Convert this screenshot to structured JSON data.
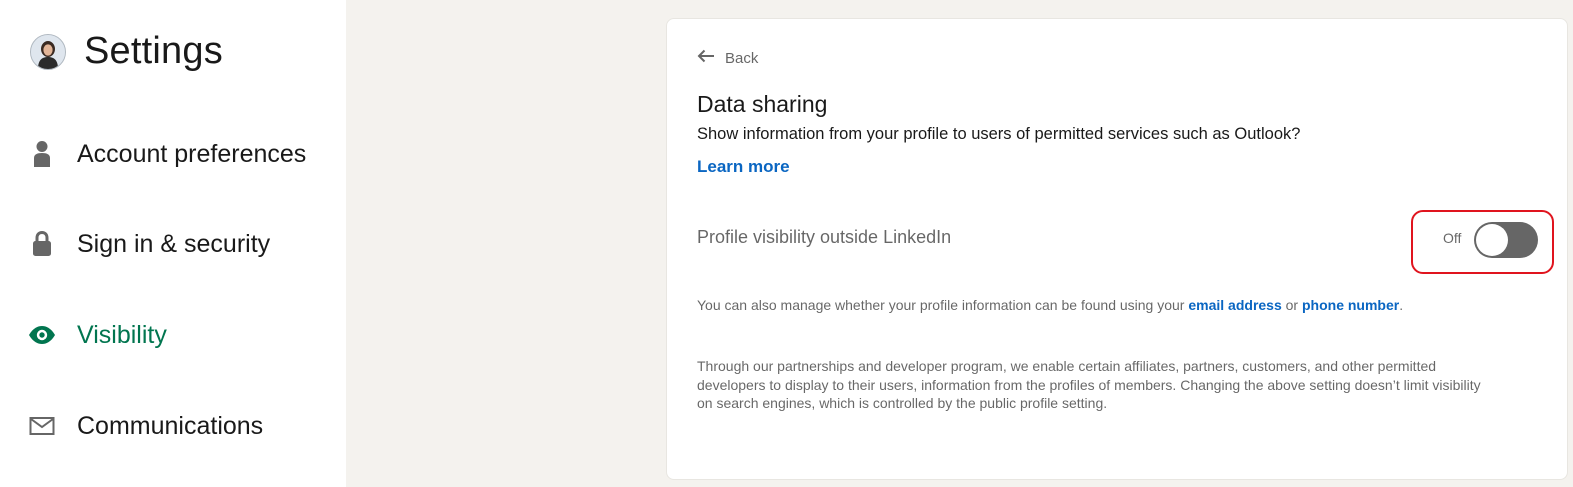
{
  "sidebar": {
    "title": "Settings",
    "items": [
      {
        "label": "Account preferences",
        "icon": "person-icon",
        "active": false
      },
      {
        "label": "Sign in & security",
        "icon": "lock-icon",
        "active": false
      },
      {
        "label": "Visibility",
        "icon": "eye-icon",
        "active": true
      },
      {
        "label": "Communications",
        "icon": "envelope-icon",
        "active": false
      }
    ]
  },
  "main": {
    "back_label": "Back",
    "section_title": "Data sharing",
    "description": "Show information from your profile to users of permitted services such as Outlook?",
    "learn_more": "Learn more",
    "setting": {
      "label": "Profile visibility outside LinkedIn",
      "state_label": "Off",
      "enabled": false
    },
    "manage_text": {
      "prefix": "You can also manage whether your profile information can be found using your",
      "email_link": "email address",
      "middle": "or",
      "phone_link": "phone number",
      "suffix": "."
    },
    "partners_text": "Through our partnerships and developer program, we enable certain affiliates, partners, customers, and other permitted developers to display to their users, information from the profiles of members. Changing the above setting doesn’t limit visibility on search engines, which is controlled by the public profile setting."
  },
  "colors": {
    "active_nav": "#01754f",
    "link": "#0a66c2",
    "highlight_border": "#e0141e",
    "toggle_off": "#666666",
    "page_background": "#f4f2ee"
  }
}
